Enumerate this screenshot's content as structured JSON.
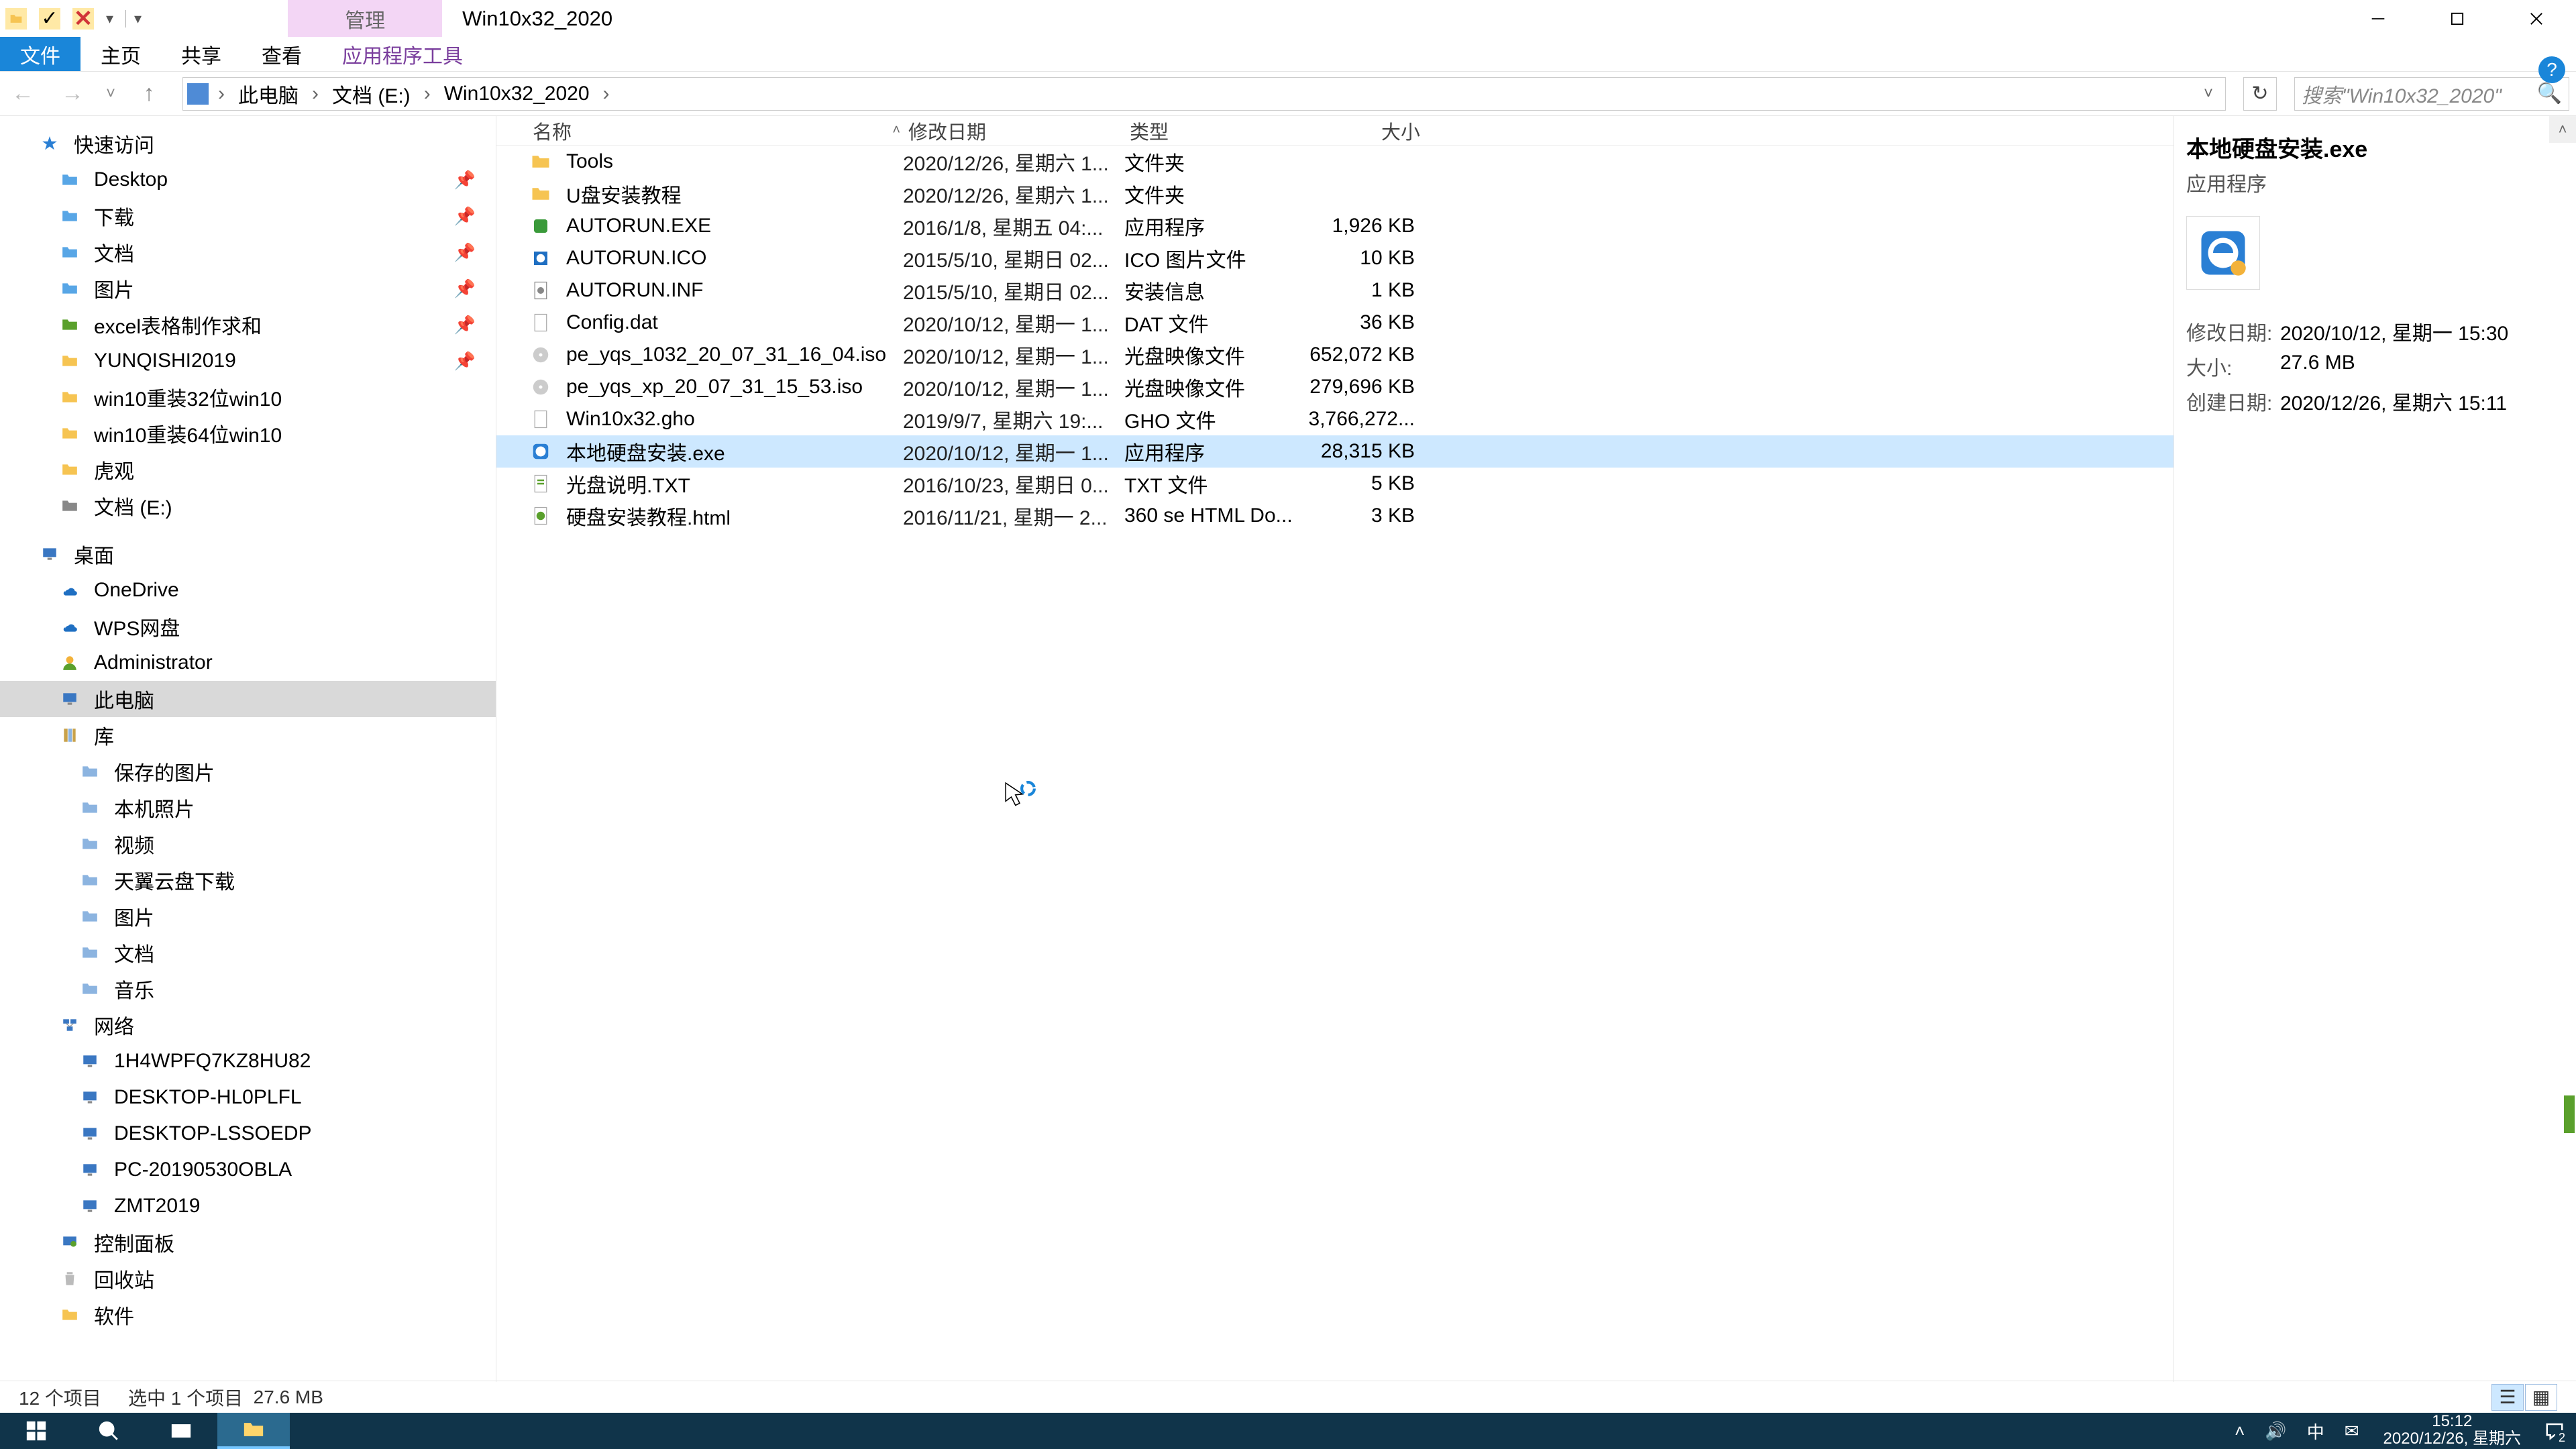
{
  "title": "Win10x32_2020",
  "tab_manage": "管理",
  "ribbon": {
    "file": "文件",
    "home": "主页",
    "share": "共享",
    "view": "查看",
    "appTools": "应用程序工具"
  },
  "breadcrumb": [
    "此电脑",
    "文档 (E:)",
    "Win10x32_2020"
  ],
  "search_placeholder": "搜索\"Win10x32_2020\"",
  "columns": {
    "name": "名称",
    "date": "修改日期",
    "type": "类型",
    "size": "大小"
  },
  "nav": {
    "quick": [
      "快速访问",
      "Desktop",
      "下载",
      "文档",
      "图片",
      "excel表格制作求和",
      "YUNQISHI2019",
      "win10重装32位win10",
      "win10重装64位win10",
      "虎观",
      "文档 (E:)"
    ],
    "desktop": "桌面",
    "cloud": [
      "OneDrive",
      "WPS网盘"
    ],
    "user": "Administrator",
    "thispc": "此电脑",
    "lib": "库",
    "lib_items": [
      "保存的图片",
      "本机照片",
      "视频",
      "天翼云盘下载",
      "图片",
      "文档",
      "音乐"
    ],
    "network": "网络",
    "net_items": [
      "1H4WPFQ7KZ8HU82",
      "DESKTOP-HL0PLFL",
      "DESKTOP-LSSOEDP",
      "PC-20190530OBLA",
      "ZMT2019"
    ],
    "ctrl": "控制面板",
    "recycle": "回收站",
    "soft": "软件"
  },
  "files": [
    {
      "name": "Tools",
      "date": "2020/12/26, 星期六 1...",
      "type": "文件夹",
      "size": "",
      "icon": "folder"
    },
    {
      "name": "U盘安装教程",
      "date": "2020/12/26, 星期六 1...",
      "type": "文件夹",
      "size": "",
      "icon": "folder"
    },
    {
      "name": "AUTORUN.EXE",
      "date": "2016/1/8, 星期五 04:...",
      "type": "应用程序",
      "size": "1,926 KB",
      "icon": "exe-green"
    },
    {
      "name": "AUTORUN.ICO",
      "date": "2015/5/10, 星期日 02...",
      "type": "ICO 图片文件",
      "size": "10 KB",
      "icon": "ico"
    },
    {
      "name": "AUTORUN.INF",
      "date": "2015/5/10, 星期日 02...",
      "type": "安装信息",
      "size": "1 KB",
      "icon": "inf"
    },
    {
      "name": "Config.dat",
      "date": "2020/10/12, 星期一 1...",
      "type": "DAT 文件",
      "size": "36 KB",
      "icon": "file"
    },
    {
      "name": "pe_yqs_1032_20_07_31_16_04.iso",
      "date": "2020/10/12, 星期一 1...",
      "type": "光盘映像文件",
      "size": "652,072 KB",
      "icon": "iso"
    },
    {
      "name": "pe_yqs_xp_20_07_31_15_53.iso",
      "date": "2020/10/12, 星期一 1...",
      "type": "光盘映像文件",
      "size": "279,696 KB",
      "icon": "iso"
    },
    {
      "name": "Win10x32.gho",
      "date": "2019/9/7, 星期六 19:...",
      "type": "GHO 文件",
      "size": "3,766,272...",
      "icon": "file"
    },
    {
      "name": "本地硬盘安装.exe",
      "date": "2020/10/12, 星期一 1...",
      "type": "应用程序",
      "size": "28,315 KB",
      "icon": "app-blue",
      "selected": true
    },
    {
      "name": "光盘说明.TXT",
      "date": "2016/10/23, 星期日 0...",
      "type": "TXT 文件",
      "size": "5 KB",
      "icon": "txt"
    },
    {
      "name": "硬盘安装教程.html",
      "date": "2016/11/21, 星期一 2...",
      "type": "360 se HTML Do...",
      "size": "3 KB",
      "icon": "html"
    }
  ],
  "details": {
    "name": "本地硬盘安装.exe",
    "type": "应用程序",
    "rows": [
      {
        "k": "修改日期:",
        "v": "2020/10/12, 星期一 15:30"
      },
      {
        "k": "大小:",
        "v": "27.6 MB"
      },
      {
        "k": "创建日期:",
        "v": "2020/12/26, 星期六 15:11"
      }
    ]
  },
  "status": {
    "count": "12 个项目",
    "sel": "选中 1 个项目",
    "size": "27.6 MB"
  },
  "taskbar": {
    "ime": "中",
    "time": "15:12",
    "date": "2020/12/26, 星期六",
    "notif_count": "2"
  }
}
